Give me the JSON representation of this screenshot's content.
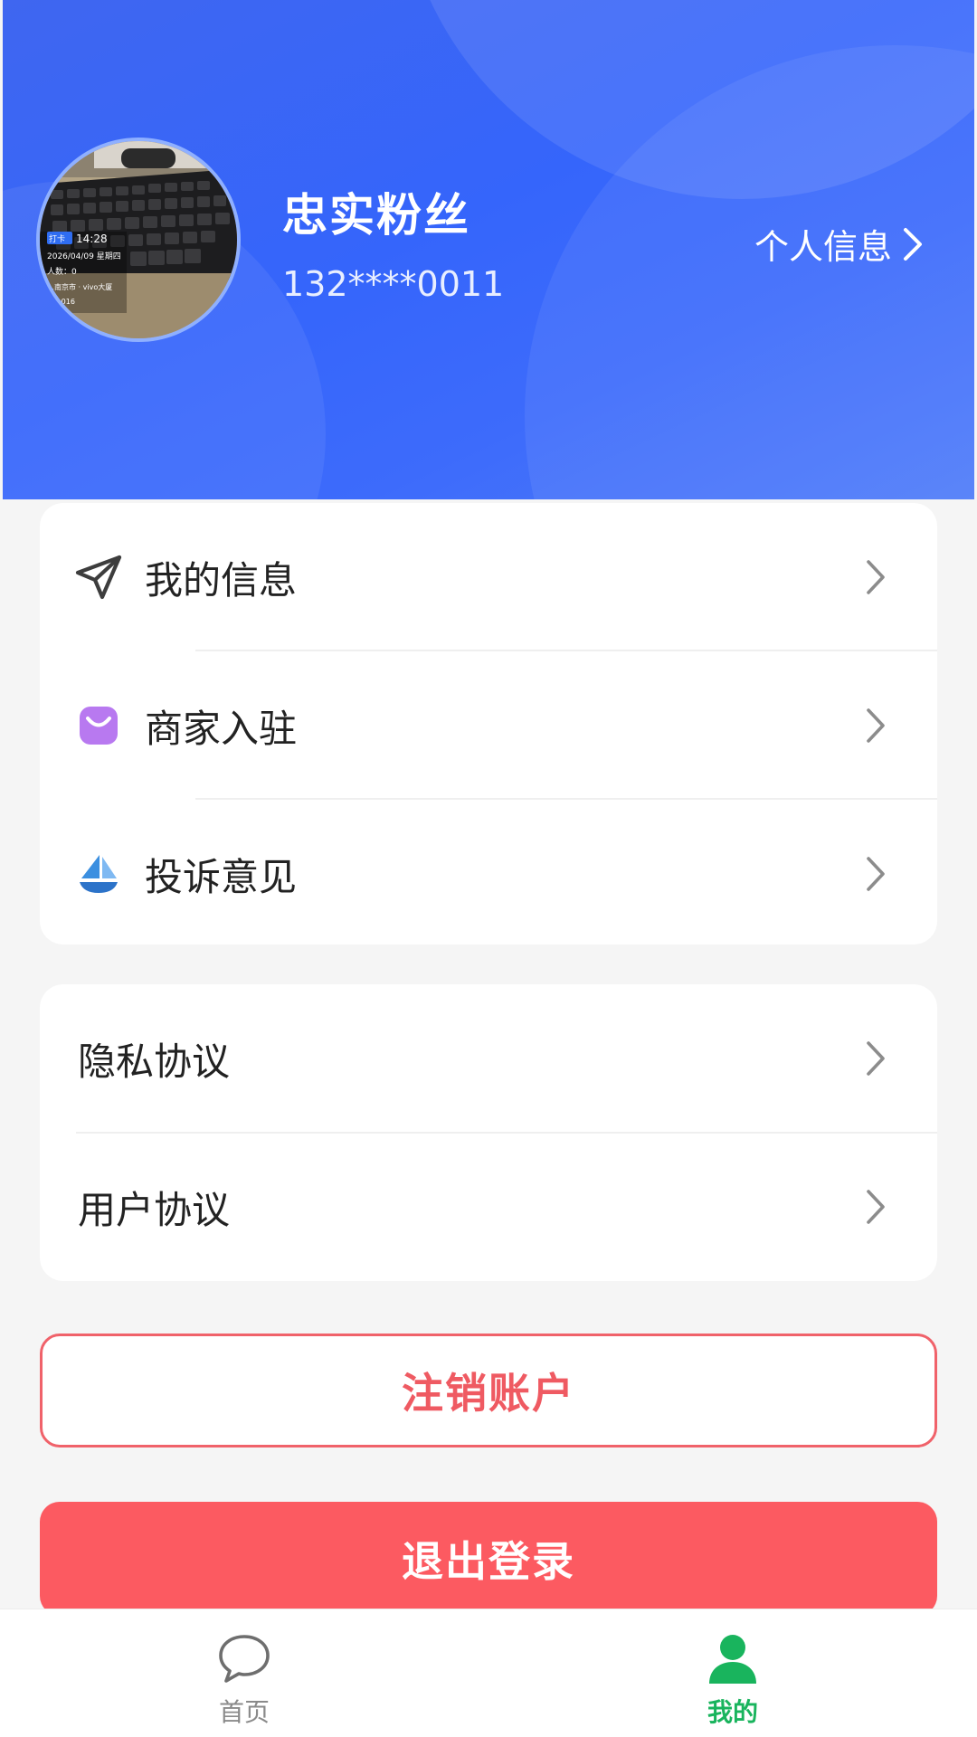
{
  "profile": {
    "name": "忠实粉丝",
    "phone": "132****0011",
    "personal_info_label": "个人信息",
    "avatar_photo_text": {
      "badge": "打卡",
      "time": "14:28",
      "date": "2026/04/09 星期四",
      "line3": "人数：0",
      "line4": "…南京市 · vivo大厦",
      "line5": "…5.016"
    }
  },
  "menu_group_1": [
    {
      "label": "我的信息",
      "icon": "paper-plane-icon"
    },
    {
      "label": "商家入驻",
      "icon": "shopping-bag-icon"
    },
    {
      "label": "投诉意见",
      "icon": "sailboat-icon"
    }
  ],
  "menu_group_2": [
    {
      "label": "隐私协议"
    },
    {
      "label": "用户协议"
    }
  ],
  "buttons": {
    "deactivate": "注销账户",
    "logout": "退出登录"
  },
  "tabbar": {
    "home": "首页",
    "mine": "我的",
    "active": "mine"
  },
  "colors": {
    "header_blue": "#3565fb",
    "danger_red": "#fc5a61",
    "active_green": "#19b45d",
    "bag_purple": "#b879f0",
    "boat_blue": "#3b8fe0"
  }
}
